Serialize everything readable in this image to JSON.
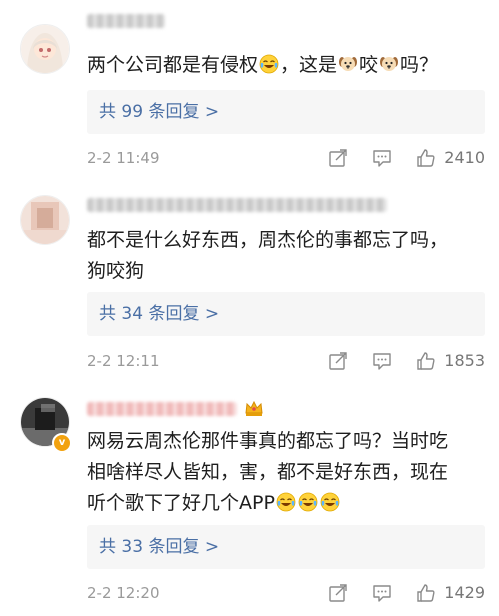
{
  "comments": [
    {
      "text_lines": [
        [
          {
            "t": "两个公司都是有侵权"
          },
          {
            "icon": "crying-laughing-emoji"
          },
          {
            "t": "，这是"
          },
          {
            "icon": "dog-emoji"
          },
          {
            "t": "咬"
          },
          {
            "icon": "dog-emoji"
          },
          {
            "t": "吗？"
          }
        ]
      ],
      "reply_label": "共 99 条回复 >",
      "time": "2-2 11:49",
      "likes": "2410"
    },
    {
      "text_lines": [
        [
          {
            "t": "都不是什么好东西，周杰伦的事都忘了吗，"
          }
        ],
        [
          {
            "t": "狗咬狗"
          }
        ]
      ],
      "reply_label": "共 34 条回复 >",
      "time": "2-2 12:11",
      "likes": "1853"
    },
    {
      "text_lines": [
        [
          {
            "t": "网易云周杰伦那件事真的都忘了吗？当时吃"
          }
        ],
        [
          {
            "t": "相啥样尽人皆知，害，都不是好东西，现在"
          }
        ],
        [
          {
            "t": "听个歌下了好几个APP"
          },
          {
            "icon": "crying-laughing-emoji"
          },
          {
            "icon": "crying-laughing-emoji"
          },
          {
            "icon": "crying-laughing-emoji"
          }
        ]
      ],
      "reply_label": "共 33 条回复 >",
      "time": "2-2 12:20",
      "likes": "1429"
    }
  ],
  "colors": {
    "reply_link": "#4a6fa5",
    "meta_text": "#9a9a9a",
    "reply_bg": "#f6f6f6",
    "badge": "#f2a20f"
  },
  "icons": {
    "actions": [
      "share-icon",
      "comment-icon",
      "like-icon"
    ]
  }
}
